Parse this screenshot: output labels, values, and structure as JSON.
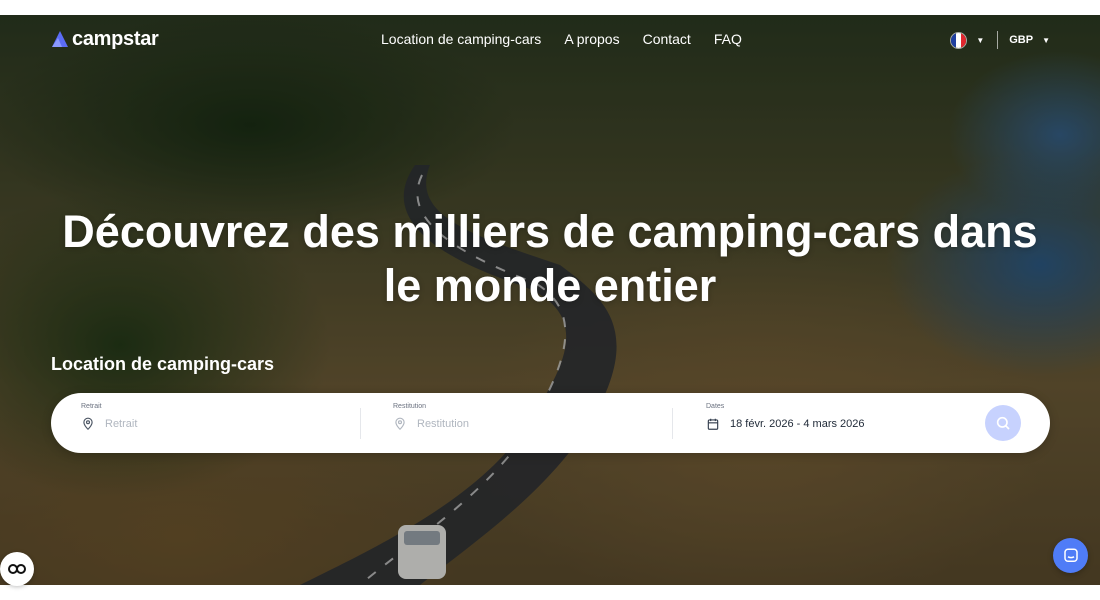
{
  "brand": {
    "name": "campstar",
    "accent": "#5b6cf6"
  },
  "nav": {
    "links": [
      "Location de camping-cars",
      "A propos",
      "Contact",
      "FAQ"
    ],
    "currency": "GBP",
    "language_flag": [
      "#1f3fa0",
      "#ffffff",
      "#e0262e"
    ]
  },
  "hero": {
    "headline": "Découvrez des milliers de camping-cars dans le monde entier"
  },
  "search": {
    "section_title": "Location de camping-cars",
    "pickup": {
      "label": "Retrait",
      "placeholder": "Retrait"
    },
    "dropoff": {
      "label": "Restitution",
      "placeholder": "Restitution"
    },
    "dates": {
      "label": "Dates",
      "value": "18 févr. 2026 - 4 mars 2026"
    }
  },
  "icons": {
    "pickup": "location-pin-icon",
    "dropoff": "location-pin-icon",
    "dates": "calendar-icon",
    "search": "search-icon",
    "consent": "cookie-consent-icon",
    "chat": "chat-icon"
  }
}
